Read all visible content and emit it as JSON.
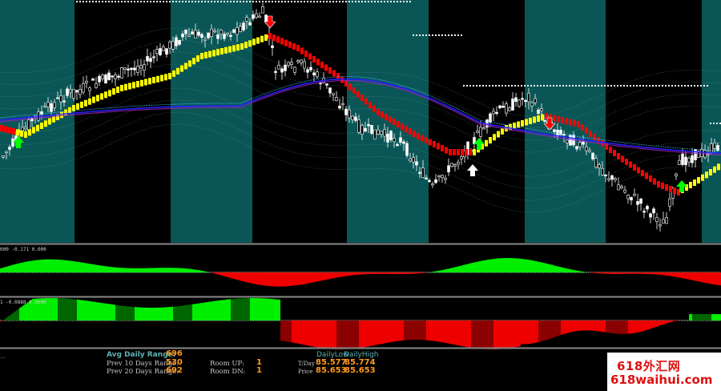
{
  "colors": {
    "session_teal": "#0a5656",
    "bull_candle": "#ffffff",
    "trend_up": "#ffff00",
    "trend_down": "#ff0000",
    "ma_blue": "#2222ff",
    "ma_purple": "#a020c0",
    "hist_green": "#00ee00",
    "hist_red": "#ee0000",
    "hist_darkgreen": "#006600",
    "hist_darkred": "#8b0000",
    "arrow_up": "#00ff00",
    "arrow_down": "#ff0000",
    "label_teal": "#5fb3b3",
    "value_orange": "#ff9a1a"
  },
  "indicator_windows": {
    "window1_label": "000 -0.171 0.000",
    "window2_label": "1 -0.0888 0.0000"
  },
  "info_panel": {
    "left_cut": "...",
    "avg_daily_range_label": "Avg Daily Range:",
    "avg_daily_range_value": "696",
    "prev10_label": "Prev 10 Days Range:",
    "prev10_value": "530",
    "prev20_label": "Prev 20 Days Range:",
    "prev20_value": "692",
    "room_up_label": "Room UP:",
    "room_up_value": "1",
    "room_dn_label": "Room DN:",
    "room_dn_value": "1",
    "daily_low_label": "DailyLow",
    "daily_high_label": "DailyHigh",
    "tday_label": "T/Day",
    "tday_low": "85.577",
    "tday_high": "85.774",
    "price_label": "Price",
    "price_low": "85.653",
    "price_high": "85.653"
  },
  "watermark": {
    "line1": "618外汇网",
    "line2": "618waihui.com"
  },
  "icons": {
    "buy_arrow": "green-up-arrow-icon",
    "sell_arrow": "red-down-arrow-icon"
  }
}
